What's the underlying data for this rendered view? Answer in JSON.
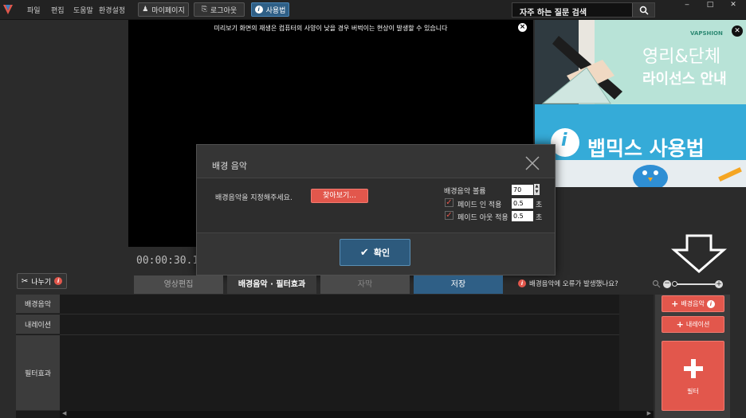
{
  "menu": {
    "file": "파일",
    "edit": "편집",
    "help": "도움말",
    "settings": "환경설정"
  },
  "top_buttons": {
    "mypage": "마이페이지",
    "logout": "로그아웃",
    "howto": "사용법"
  },
  "faq": {
    "label": "자주 하는 질문 검색"
  },
  "window_controls": {
    "minimize": "‒",
    "maximize": "□",
    "close": "✕"
  },
  "preview": {
    "note": "미리보기 화면의 재생은 컴퓨터의 사양이 낮을 경우 버벅이는 현상이 발생할 수 있습니다",
    "timecode": "00:00:30.1"
  },
  "ads": {
    "ad1": {
      "brand": "VAPSHION",
      "line1": "영리&단체",
      "line2": "라이선스 안내"
    },
    "ad2": {
      "title": "뱁믹스 사용법"
    }
  },
  "dialog": {
    "title": "배경 음악",
    "prompt": "배경음악을 지정해주세요.",
    "browse": "찾아보기...",
    "volume_label": "배경음악 볼륨",
    "volume_value": "70",
    "fade_in_label": "페이드 인 적용",
    "fade_in_value": "0.5",
    "fade_out_label": "페이드 아웃 적용",
    "fade_out_value": "0.5",
    "unit": "초",
    "fade_in_checked": true,
    "fade_out_checked": true,
    "confirm": "확인"
  },
  "split": {
    "label": "나누기"
  },
  "tabs": [
    {
      "label": "영상편집",
      "state": "inactive"
    },
    {
      "label": "배경음악 · 필터효과",
      "state": "active"
    },
    {
      "label": "자막",
      "state": "inactive"
    },
    {
      "label": "저장",
      "state": "highlight"
    }
  ],
  "error_note": "배경음악에 오류가 발생했나요?",
  "timeline_rows": {
    "bgm": "배경음악",
    "narration": "내레이션",
    "filter": "필터효과"
  },
  "side_buttons": {
    "bgm": "배경음악",
    "narration": "내레이션",
    "filter": "필터"
  },
  "colors": {
    "accent_red": "#e2574c",
    "accent_blue": "#2f5f86",
    "bg_dark": "#2b2b2b"
  }
}
